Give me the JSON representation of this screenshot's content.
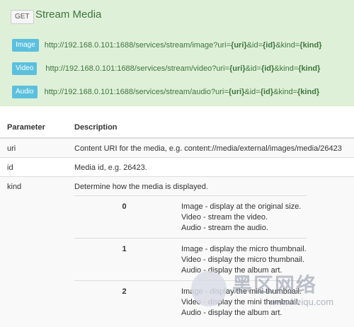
{
  "header": {
    "method": "GET",
    "title": "Stream Media"
  },
  "endpoints": [
    {
      "label": "Image",
      "prefix": "http://192.168.0.101:1688/services/stream/image?uri=",
      "p1": "{uri}",
      "mid1": "&id=",
      "p2": "{id}",
      "mid2": "&kind=",
      "p3": "{kind}"
    },
    {
      "label": "Video",
      "prefix": "http://192.168.0.101:1688/services/stream/video?uri=",
      "p1": "{uri}",
      "mid1": "&id=",
      "p2": "{id}",
      "mid2": "&kind=",
      "p3": "{kind}"
    },
    {
      "label": "Audio",
      "prefix": "http://192.168.0.101:1688/services/stream/audio?uri=",
      "p1": "{uri}",
      "mid1": "&id=",
      "p2": "{id}",
      "mid2": "&kind=",
      "p3": "{kind}"
    }
  ],
  "table": {
    "headers": [
      "Parameter",
      "Description"
    ],
    "rows": [
      {
        "param": "uri",
        "desc": "Content URI for the media, e.g. content://media/external/images/media/26423"
      },
      {
        "param": "id",
        "desc": "Media id, e.g. 26423."
      },
      {
        "param": "kind",
        "desc": "Determine how the media is displayed."
      }
    ],
    "kinds": [
      {
        "value": "0",
        "lines": [
          "Image - display at the original size.",
          "Video - stream the video.",
          "Audio - stream the audio."
        ]
      },
      {
        "value": "1",
        "lines": [
          "Image - display the micro thumbnail.",
          "Video - display the micro thumbnail.",
          "Audio - display the album art."
        ]
      },
      {
        "value": "2",
        "lines": [
          "Image - display the mini thumbnail.",
          "Video - display the mini thumbnail.",
          "Audio - display the album art."
        ]
      }
    ]
  },
  "watermark": {
    "text_cn": "黑区网络",
    "url": "www.heiqu.com"
  }
}
